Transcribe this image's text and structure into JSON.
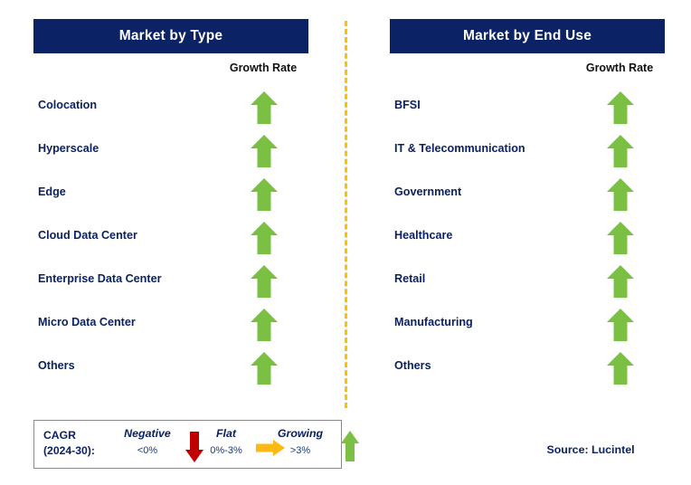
{
  "colors": {
    "header_bg": "#0b2265",
    "header_text": "#ffffff",
    "label_navy": "#0b2265",
    "arrow_green": "#7ac043",
    "arrow_red": "#c00000",
    "arrow_orange": "#fcb913",
    "divider_dashed": "#fcc200",
    "legend_border": "#8a8a8a",
    "growth_rate_text": "#111111"
  },
  "panels": [
    {
      "id": "market-by-type",
      "title": "Market by Type",
      "column_header": "Growth Rate",
      "rows": [
        {
          "label": "Colocation",
          "growth": "up",
          "icon": "arrow-up-icon"
        },
        {
          "label": "Hyperscale",
          "growth": "up",
          "icon": "arrow-up-icon"
        },
        {
          "label": "Edge",
          "growth": "up",
          "icon": "arrow-up-icon"
        },
        {
          "label": "Cloud Data Center",
          "growth": "up",
          "icon": "arrow-up-icon"
        },
        {
          "label": "Enterprise Data Center",
          "growth": "up",
          "icon": "arrow-up-icon"
        },
        {
          "label": "Micro Data Center",
          "growth": "up",
          "icon": "arrow-up-icon"
        },
        {
          "label": "Others",
          "growth": "up",
          "icon": "arrow-up-icon"
        }
      ]
    },
    {
      "id": "market-by-end-use",
      "title": "Market by End Use",
      "column_header": "Growth Rate",
      "rows": [
        {
          "label": "BFSI",
          "growth": "up",
          "icon": "arrow-up-icon"
        },
        {
          "label": "IT & Telecommunication",
          "growth": "up",
          "icon": "arrow-up-icon"
        },
        {
          "label": "Government",
          "growth": "up",
          "icon": "arrow-up-icon"
        },
        {
          "label": "Healthcare",
          "growth": "up",
          "icon": "arrow-up-icon"
        },
        {
          "label": "Retail",
          "growth": "up",
          "icon": "arrow-up-icon"
        },
        {
          "label": "Manufacturing",
          "growth": "up",
          "icon": "arrow-up-icon"
        },
        {
          "label": "Others",
          "growth": "up",
          "icon": "arrow-up-icon"
        }
      ]
    }
  ],
  "legend": {
    "title_line1": "CAGR",
    "title_line2": "(2024-30):",
    "items": [
      {
        "name": "Negative",
        "range": "<0%",
        "icon": "arrow-down-icon",
        "color": "#c00000"
      },
      {
        "name": "Flat",
        "range": "0%-3%",
        "icon": "arrow-right-icon",
        "color": "#fcb913"
      },
      {
        "name": "Growing",
        "range": ">3%",
        "icon": "arrow-up-icon",
        "color": "#7ac043"
      }
    ]
  },
  "source": "Source: Lucintel"
}
